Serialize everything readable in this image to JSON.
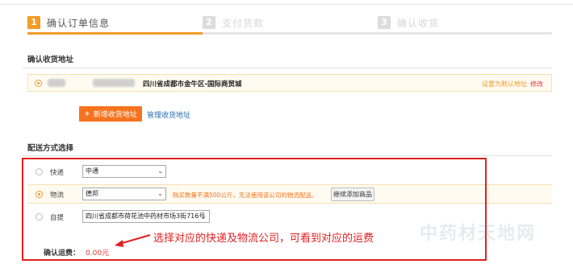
{
  "steps": [
    {
      "num": "1",
      "label": "确认订单信息"
    },
    {
      "num": "2",
      "label": "支付货款"
    },
    {
      "num": "3",
      "label": "确认收货"
    }
  ],
  "address_section": {
    "title": "确认收货地址",
    "address": "四川省成都市金牛区-国际商贸城",
    "set_default": "设置为默认地址",
    "modify": "修改",
    "add_button": "新增收货地址",
    "manage_link": "管理收货地址"
  },
  "shipping_section": {
    "title": "配送方式选择",
    "options": [
      {
        "label": "快递",
        "selected_value": "中通"
      },
      {
        "label": "物流",
        "selected_value": "德邦",
        "warning": "购买数量不满500公斤，无法使用该公司的物流配送。",
        "continue_button": "继续添加商品"
      },
      {
        "label": "自提",
        "selected_value": "四川省成都市荷花池中药材市场3街716号"
      }
    ],
    "fee_label": "确认运费：",
    "fee_value": "0.00元"
  },
  "annotation": "选择对应的快递及物流公司，可看到对应的运费",
  "watermark": "中药材天地网",
  "colors": {
    "accent": "#f39b28",
    "highlight": "#e02020",
    "link": "#2a6bb3"
  }
}
